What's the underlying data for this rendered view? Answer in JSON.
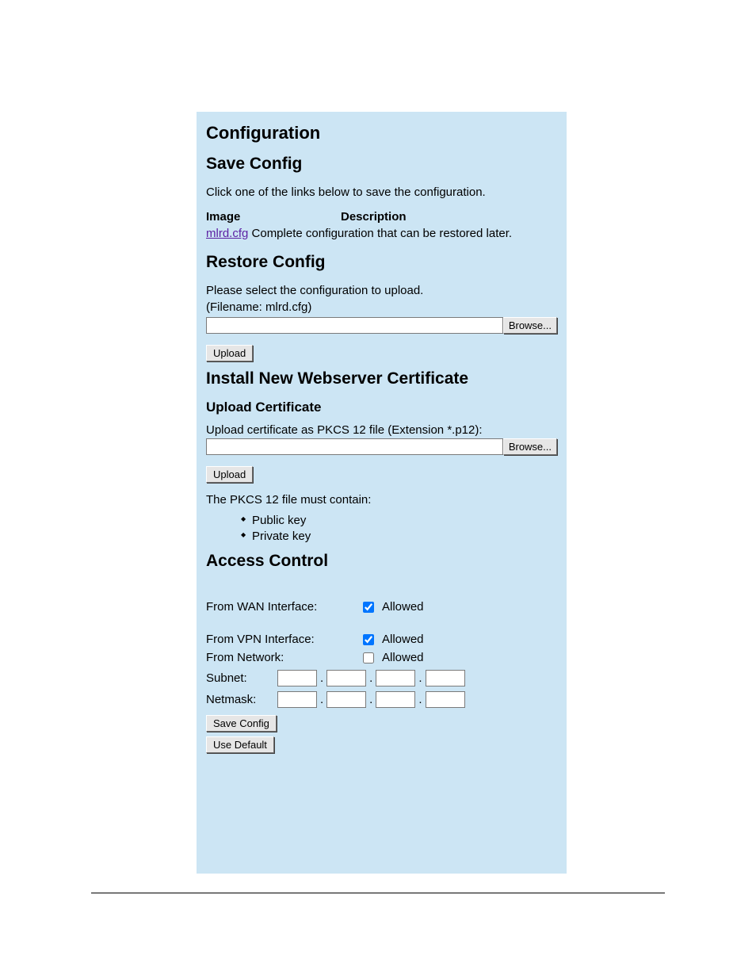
{
  "headings": {
    "main": "Configuration",
    "save": "Save Config",
    "restore": "Restore Config",
    "install": "Install New Webserver Certificate",
    "upload_cert": "Upload Certificate",
    "access": "Access Control"
  },
  "save_section": {
    "intro": "Click one of the links below to save the configuration.",
    "col_image": "Image",
    "col_desc": "Description",
    "link_text": "mlrd.cfg",
    "desc_text": "Complete configuration that can be restored later."
  },
  "restore_section": {
    "line1": "Please select the configuration to upload.",
    "line2": "(Filename: mlrd.cfg)",
    "browse": "Browse...",
    "upload": "Upload"
  },
  "cert_section": {
    "prompt": "Upload certificate as PKCS 12 file (Extension *.p12):",
    "browse": "Browse...",
    "upload": "Upload",
    "must_contain": "The PKCS 12 file must contain:",
    "bullet1": "Public key",
    "bullet2": "Private key"
  },
  "access_section": {
    "wan_label": "From WAN Interface:",
    "vpn_label": "From VPN Interface:",
    "net_label": "From Network:",
    "allowed": "Allowed",
    "subnet_label": "Subnet:",
    "netmask_label": "Netmask:",
    "save_btn": "Save Config",
    "default_btn": "Use Default",
    "wan_checked": true,
    "vpn_checked": true,
    "net_checked": false
  }
}
